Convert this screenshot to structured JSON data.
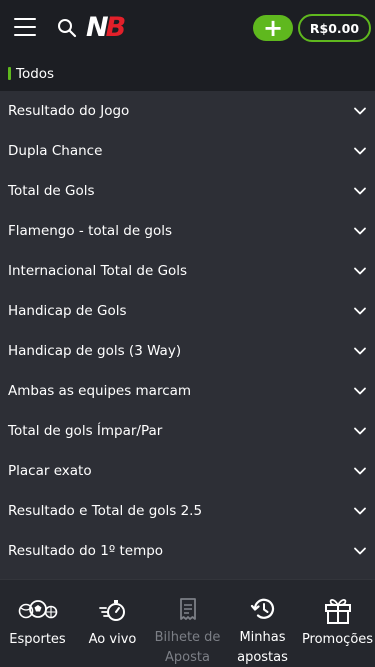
{
  "header": {
    "logo_n": "N",
    "logo_b": "B",
    "plus_label": "+",
    "balance": "R$0.00"
  },
  "filter": {
    "label": "Todos"
  },
  "markets": [
    {
      "label": "Resultado do Jogo"
    },
    {
      "label": "Dupla Chance"
    },
    {
      "label": "Total de Gols"
    },
    {
      "label": "Flamengo - total de gols"
    },
    {
      "label": "Internacional Total de Gols"
    },
    {
      "label": "Handicap de Gols"
    },
    {
      "label": "Handicap de gols (3 Way)"
    },
    {
      "label": "Ambas as equipes marcam"
    },
    {
      "label": "Total de gols Ímpar/Par"
    },
    {
      "label": "Placar exato"
    },
    {
      "label": "Resultado e Total de gols 2.5"
    },
    {
      "label": "Resultado do 1º tempo"
    }
  ],
  "bottom_nav": {
    "sports": "Esportes",
    "live": "Ao vivo",
    "betslip_line1": "Bilhete de",
    "betslip_line2": "Aposta",
    "mybets_line1": "Minhas",
    "mybets_line2": "apostas",
    "promos": "Promoções"
  },
  "colors": {
    "accent_green": "#5fb81e",
    "logo_red": "#e3202a",
    "background": "#1c1e23",
    "row_background": "#2d2f36"
  },
  "icons": [
    "menu-icon",
    "search-icon",
    "chevron-down-icon",
    "sports-balls-icon",
    "live-stopwatch-icon",
    "betslip-receipt-icon",
    "history-clock-icon",
    "gift-icon"
  ]
}
